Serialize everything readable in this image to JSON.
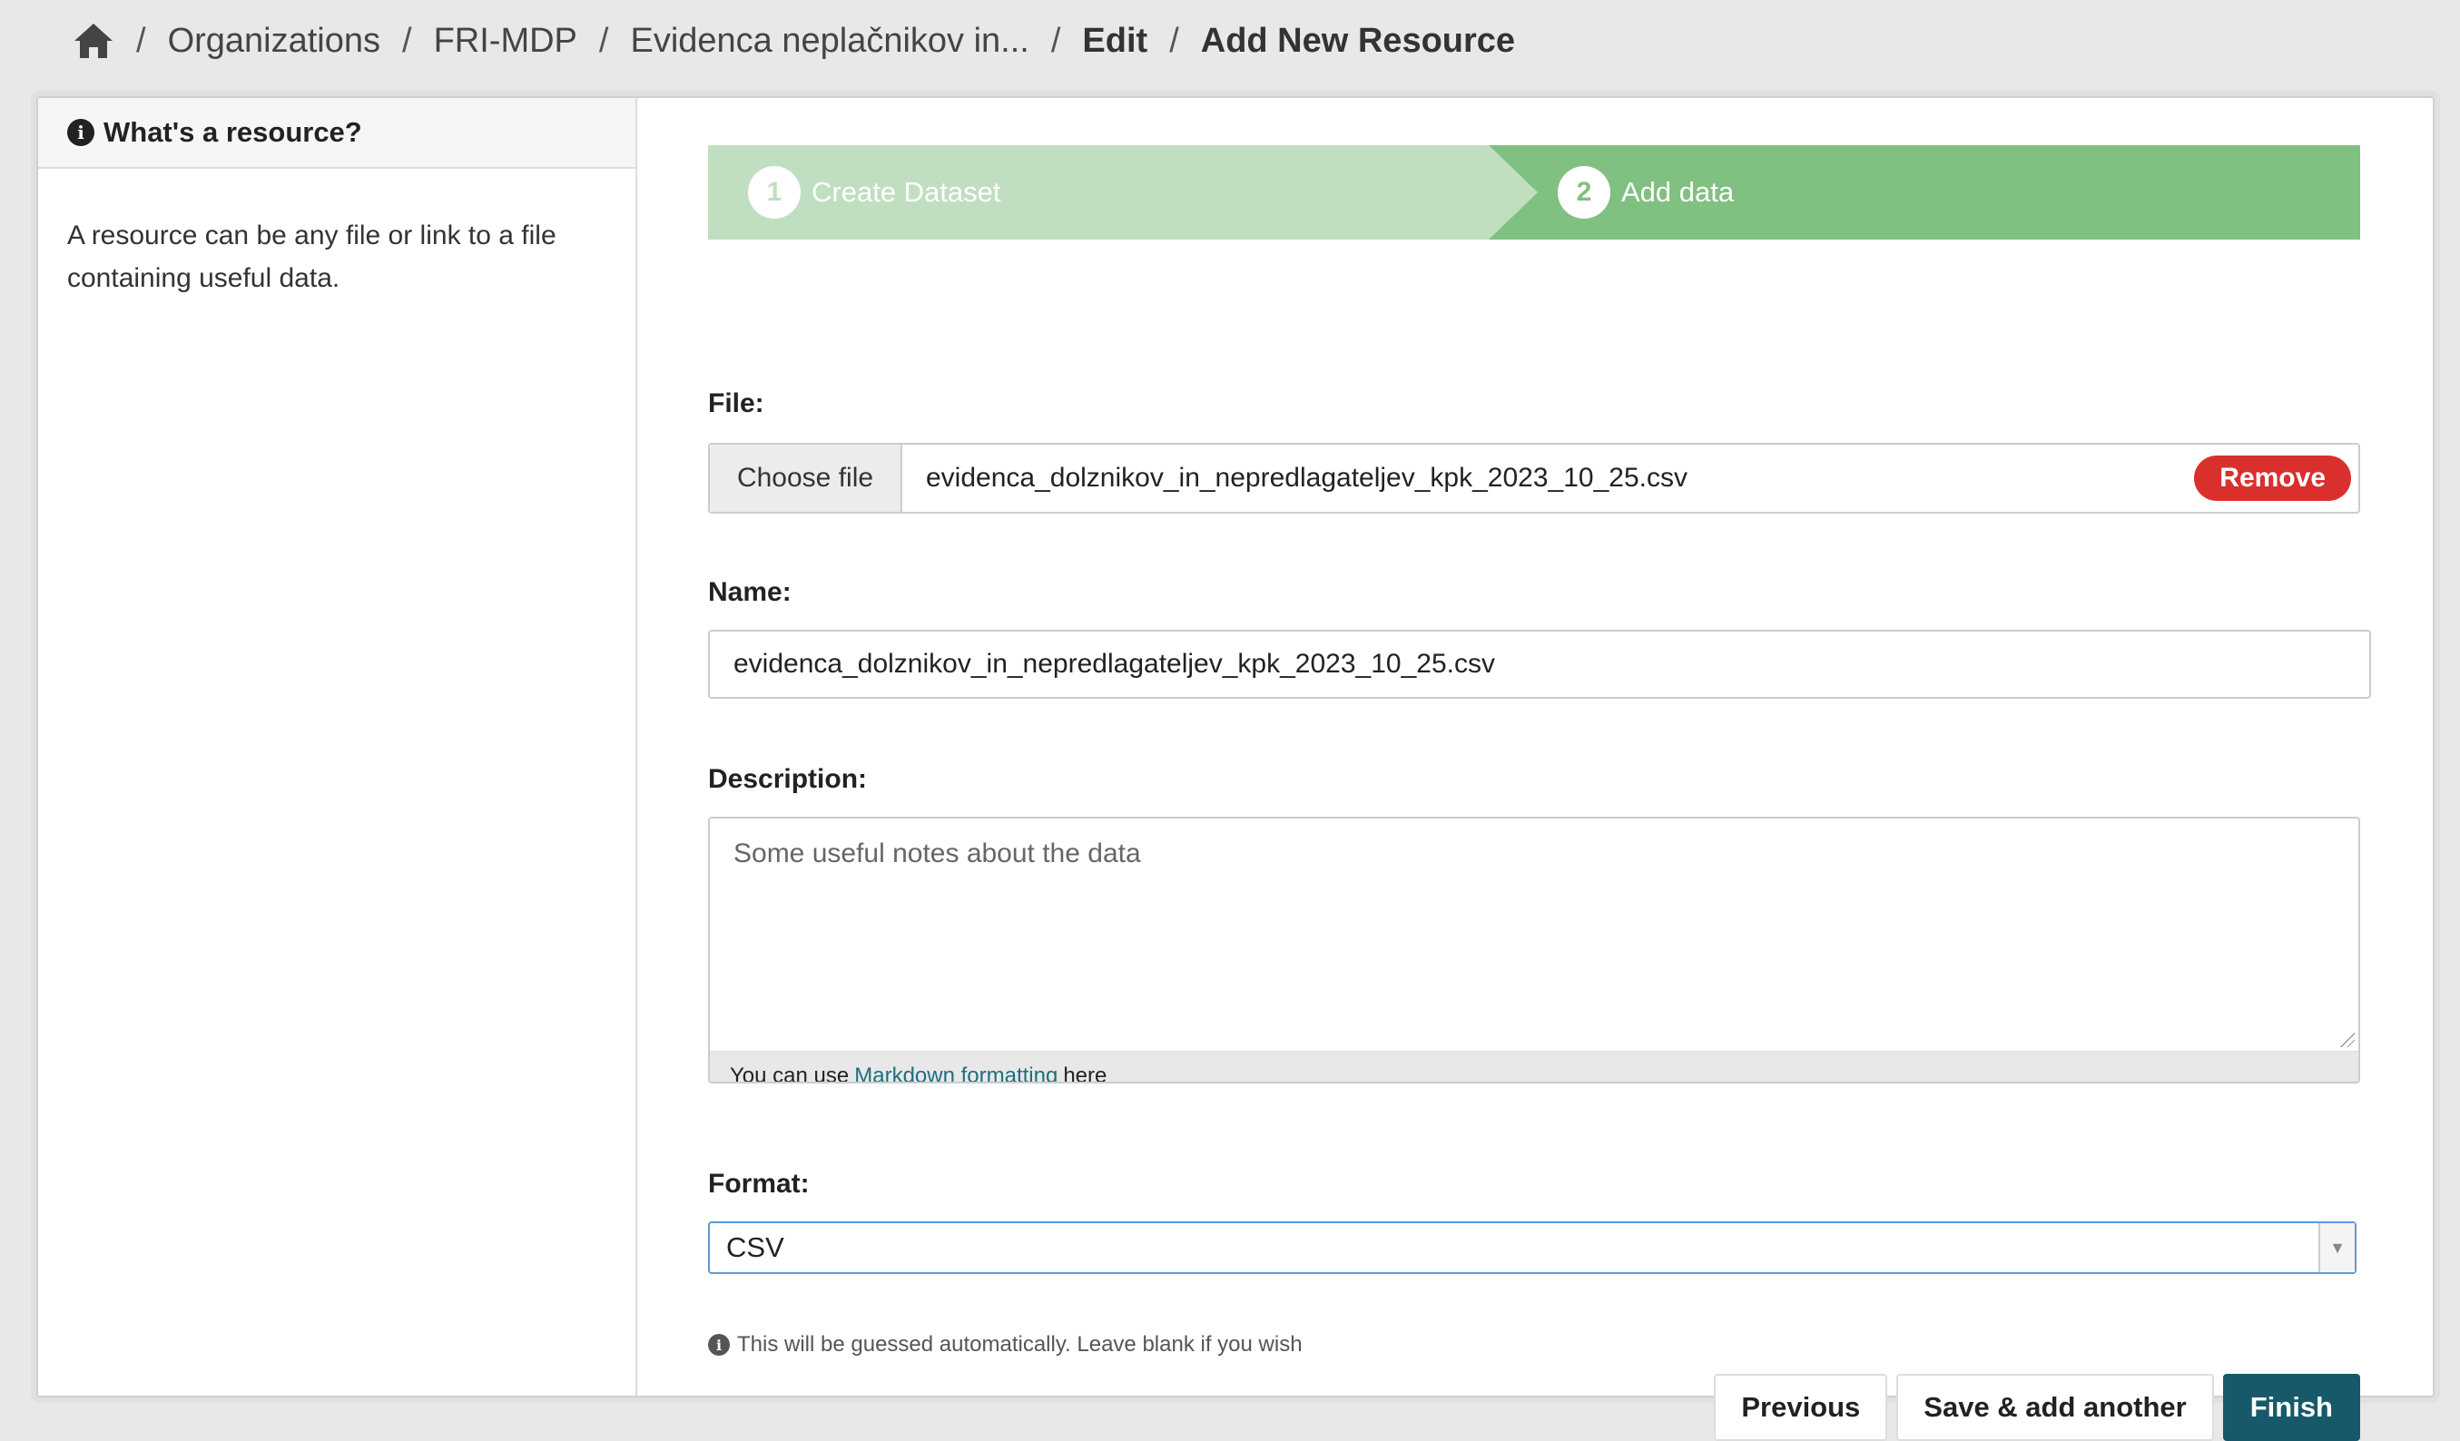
{
  "breadcrumb": {
    "items": [
      "Organizations",
      "FRI-MDP",
      "Evidenca neplačnikov in...",
      "Edit",
      "Add New Resource"
    ],
    "separator": "/"
  },
  "sidebar": {
    "title": "What's a resource?",
    "text": "A resource can be any file or link to a file containing useful data."
  },
  "stages": [
    {
      "number": "1",
      "label": "Create Dataset",
      "state": "complete"
    },
    {
      "number": "2",
      "label": "Add data",
      "state": "active"
    }
  ],
  "form": {
    "file": {
      "label": "File:",
      "choose_label": "Choose file",
      "file_name": "evidenca_dolznikov_in_nepredlagateljev_kpk_2023_10_25.csv",
      "remove_label": "Remove"
    },
    "name": {
      "label": "Name:",
      "value": "evidenca_dolznikov_in_nepredlagateljev_kpk_2023_10_25.csv"
    },
    "description": {
      "label": "Description:",
      "placeholder": "Some useful notes about the data",
      "help_prefix": "You can use",
      "help_link": "Markdown formatting",
      "help_suffix": "here"
    },
    "format": {
      "label": "Format:",
      "value": "CSV",
      "help": "This will be guessed automatically. Leave blank if you wish"
    }
  },
  "buttons": {
    "previous": "Previous",
    "save_add": "Save & add another",
    "finish": "Finish"
  },
  "colors": {
    "stage_complete": "#c0dfc0",
    "stage_active": "#80c081",
    "remove": "#d9302e",
    "primary": "#17596a",
    "link": "#1f6e7e"
  }
}
